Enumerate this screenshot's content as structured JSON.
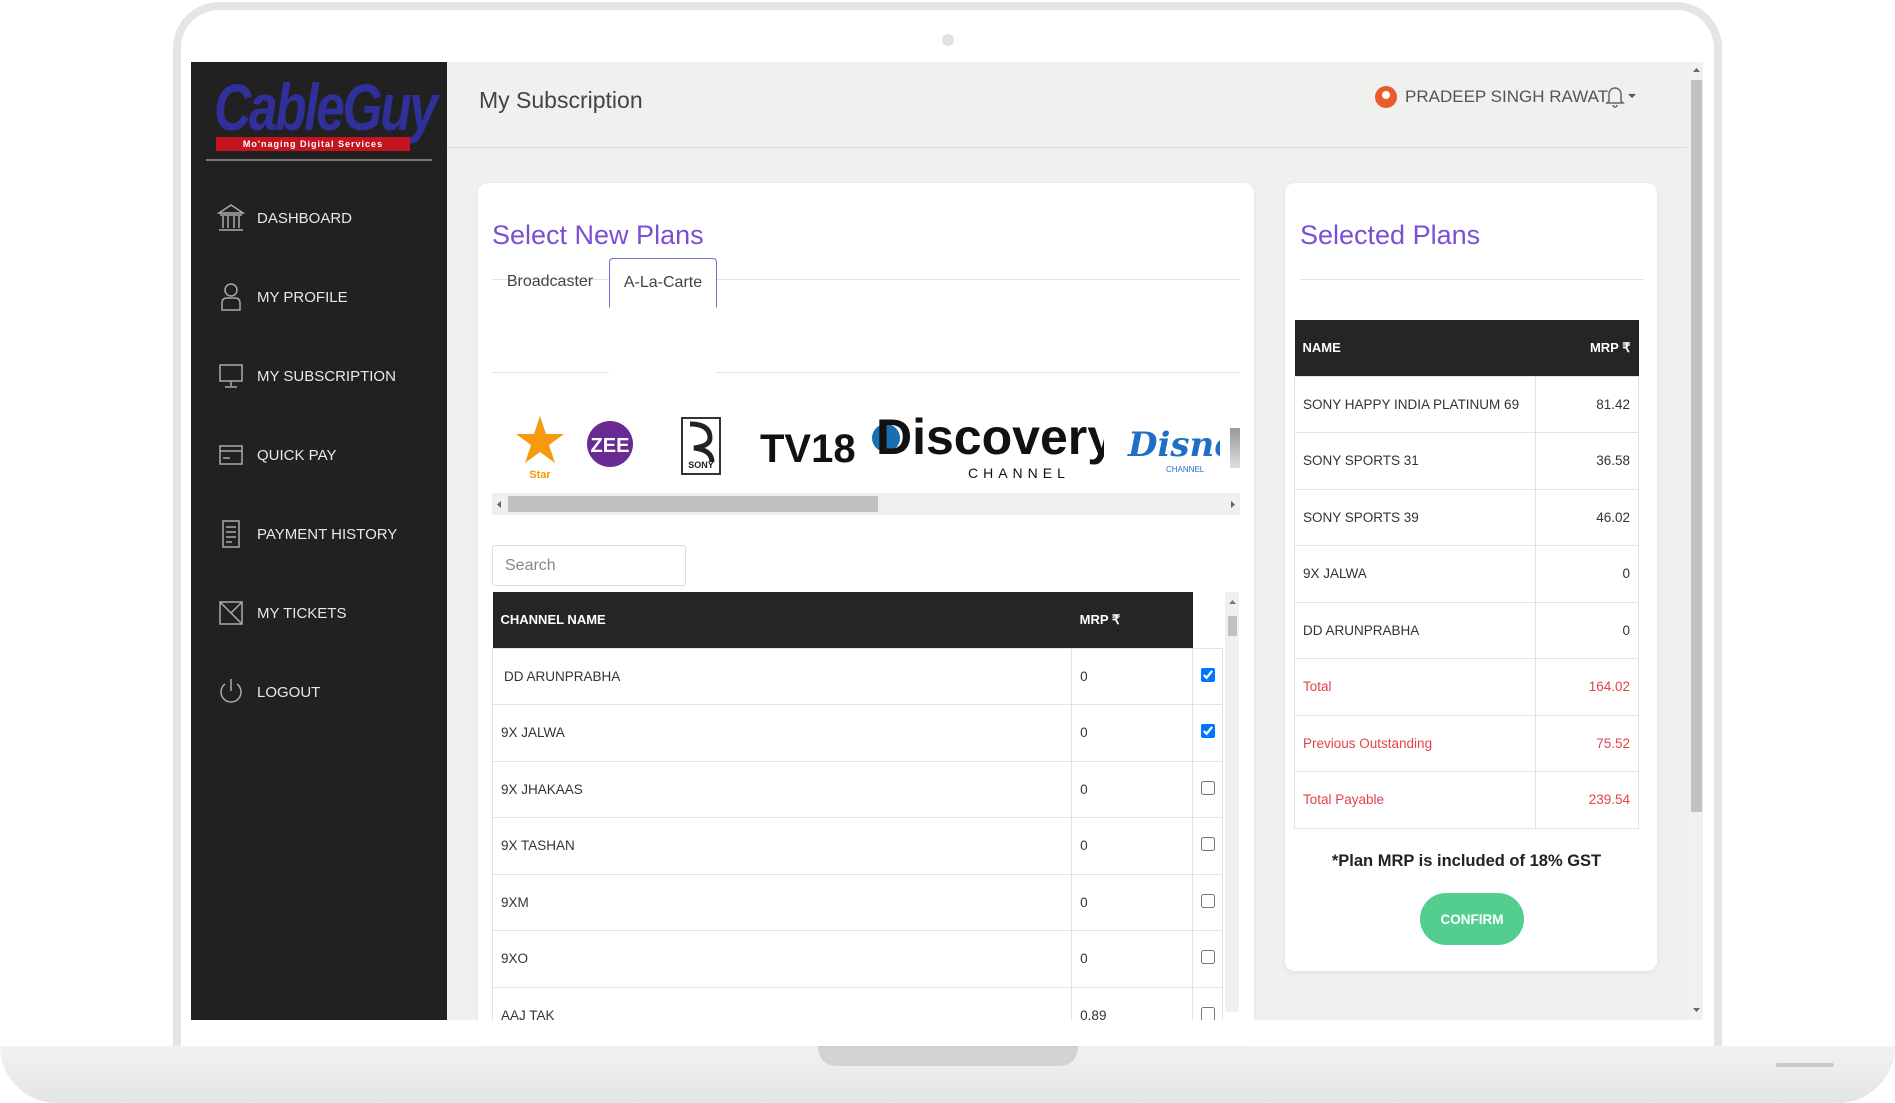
{
  "app": {
    "logo_text": "CableGuy",
    "logo_tagline": "Mo'naging Digital Services"
  },
  "sidebar": {
    "items": [
      {
        "label": "DASHBOARD",
        "icon": "bank-icon"
      },
      {
        "label": "MY PROFILE",
        "icon": "user-icon"
      },
      {
        "label": "MY SUBSCRIPTION",
        "icon": "monitor-icon"
      },
      {
        "label": "QUICK PAY",
        "icon": "card-icon"
      },
      {
        "label": "PAYMENT HISTORY",
        "icon": "receipt-icon"
      },
      {
        "label": "MY TICKETS",
        "icon": "ticket-icon"
      },
      {
        "label": "LOGOUT",
        "icon": "power-icon"
      }
    ]
  },
  "header": {
    "title": "My Subscription",
    "user_name": "PRADEEP SINGH RAWAT"
  },
  "select_plans": {
    "title": "Select New Plans",
    "tabs": [
      "Broadcaster",
      "A-La-Carte"
    ],
    "active_tab": "A-La-Carte",
    "broadcasters": [
      "Star",
      "ZEE",
      "SONY",
      "TV18",
      "Discovery",
      "CHANNEL",
      "Disney",
      "CHANNEL"
    ],
    "search_placeholder": "Search",
    "columns": [
      "CHANNEL NAME",
      "MRP ₹"
    ],
    "rows": [
      {
        "name": "DD ARUNPRABHA",
        "mrp": "0",
        "checked": true
      },
      {
        "name": "9X JALWA",
        "mrp": "0",
        "checked": true
      },
      {
        "name": "9X JHAKAAS",
        "mrp": "0",
        "checked": false
      },
      {
        "name": "9X TASHAN",
        "mrp": "0",
        "checked": false
      },
      {
        "name": "9XM",
        "mrp": "0",
        "checked": false
      },
      {
        "name": "9XO",
        "mrp": "0",
        "checked": false
      },
      {
        "name": "AAJ TAK",
        "mrp": "0.89",
        "checked": false
      }
    ]
  },
  "selected_plans": {
    "title": "Selected Plans",
    "columns": [
      "NAME",
      "MRP ₹"
    ],
    "rows": [
      {
        "name": "SONY HAPPY INDIA PLATINUM 69",
        "mrp": "81.42"
      },
      {
        "name": "SONY SPORTS 31",
        "mrp": "36.58"
      },
      {
        "name": "SONY SPORTS 39",
        "mrp": "46.02"
      },
      {
        "name": "9X JALWA",
        "mrp": "0"
      },
      {
        "name": "DD ARUNPRABHA",
        "mrp": "0"
      }
    ],
    "totals": [
      {
        "label": "Total",
        "value": "164.02"
      },
      {
        "label": "Previous Outstanding",
        "value": "75.52"
      },
      {
        "label": "Total Payable",
        "value": "239.54"
      }
    ],
    "gst_note": "*Plan MRP is included of 18% GST",
    "confirm_label": "CONFIRM"
  },
  "colors": {
    "accent": "#7a4fd6",
    "sidebar": "#212121",
    "confirm": "#52cf8e",
    "total_red": "#e2434b"
  }
}
